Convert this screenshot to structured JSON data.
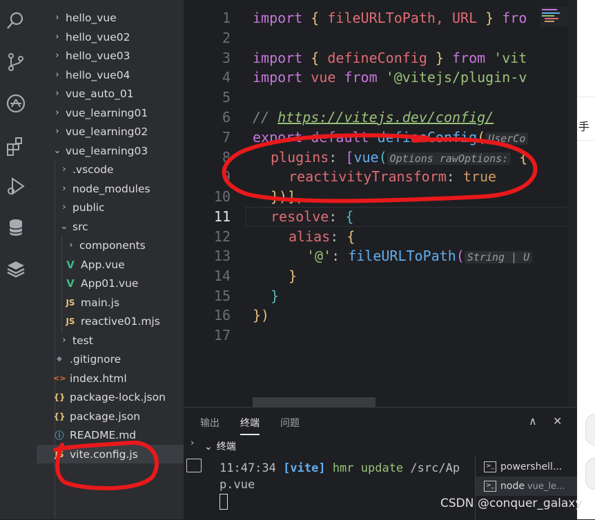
{
  "explorer": {
    "items": [
      {
        "label": "hello_vue",
        "chevron": "›"
      },
      {
        "label": "hello_vue02",
        "chevron": "›"
      },
      {
        "label": "hello_vue03",
        "chevron": "›"
      },
      {
        "label": "hello_vue04",
        "chevron": "›"
      },
      {
        "label": "vue_auto_01",
        "chevron": "›"
      },
      {
        "label": "vue_learning01",
        "chevron": "›"
      },
      {
        "label": "vue_learning02",
        "chevron": "›"
      },
      {
        "label": "vue_learning03",
        "chevron": "⌄"
      },
      {
        "label": ".vscode",
        "chevron": "›"
      },
      {
        "label": "node_modules",
        "chevron": "›"
      },
      {
        "label": "public",
        "chevron": "›"
      },
      {
        "label": "src",
        "chevron": "⌄"
      },
      {
        "label": "components",
        "chevron": "›"
      },
      {
        "label": "App.vue",
        "icon": "V"
      },
      {
        "label": "App01.vue",
        "icon": "V"
      },
      {
        "label": "main.js",
        "icon": "JS"
      },
      {
        "label": "reactive01.mjs",
        "icon": "JS"
      },
      {
        "label": "test",
        "chevron": "›"
      },
      {
        "label": ".gitignore",
        "icon": "◆"
      },
      {
        "label": "index.html",
        "icon": "<>"
      },
      {
        "label": "package-lock.json",
        "icon": "{}"
      },
      {
        "label": "package.json",
        "icon": "{}"
      },
      {
        "label": "README.md",
        "icon": "ⓘ"
      },
      {
        "label": "vite.config.js",
        "icon": "JS"
      }
    ]
  },
  "editor": {
    "line_numbers": [
      "1",
      "2",
      "3",
      "4",
      "5",
      "6",
      "7",
      "8",
      "9",
      "10",
      "11",
      "12",
      "13",
      "14",
      "15",
      "16",
      "17"
    ],
    "code": {
      "l1_import": "import",
      "l1_open": "{",
      "l1_names": " fileURLToPath, URL ",
      "l1_close": "}",
      "l1_from": " fro",
      "l3_import": "import",
      "l3_open": "{",
      "l3_name": " defineConfig ",
      "l3_close": "}",
      "l3_from": " from ",
      "l3_str": "'vit",
      "l4_import": "import",
      "l4_name": " vue ",
      "l4_from": "from ",
      "l4_str": "'@vitejs/plugin-v",
      "l6_comment": "// ",
      "l6_url": "https://vitejs.dev/config/",
      "l7_export": "export default ",
      "l7_fn": "defineConfig",
      "l7_paren": "(",
      "l7_hint": "UserCo",
      "l8_key": "plugins",
      "l8_colon": ": ",
      "l8_bracket": "[",
      "l8_fn": "vue",
      "l8_paren": "(",
      "l8_hint": "Options rawOptions:",
      "l8_brace": " {",
      "l9_key": "reactivityTransform",
      "l9_colon": ": ",
      "l9_val": "true",
      "l10_close": "})],",
      "l11_key": "resolve",
      "l11_colon": ": ",
      "l11_brace": "{",
      "l12_key": "alias",
      "l12_colon": ": ",
      "l12_brace": "{",
      "l13_str": "'@'",
      "l13_colon": ": ",
      "l13_fn": "fileURLToPath",
      "l13_paren": "(",
      "l13_hint": "String | U",
      "l14_close": "}",
      "l15_close": "}",
      "l16_close": "})"
    }
  },
  "panel": {
    "tabs": [
      "输出",
      "终端",
      "问题"
    ],
    "controls": {
      "collapse": "∧",
      "close": "✕"
    },
    "section": "终端",
    "terminal_time": "11:47:34",
    "terminal_tag": "[vite]",
    "terminal_action": "hmr update",
    "terminal_path": "/src/Ap",
    "terminal_path2": "p.vue",
    "sessions": [
      {
        "name": "powershell...",
        "sub": ""
      },
      {
        "name": "node",
        "sub": "vue_le..."
      }
    ]
  },
  "outside_text": "手",
  "watermark": "CSDN @conquer_galaxy",
  "colors": {
    "annotation": "#e8191b",
    "accent": "#61afef"
  }
}
